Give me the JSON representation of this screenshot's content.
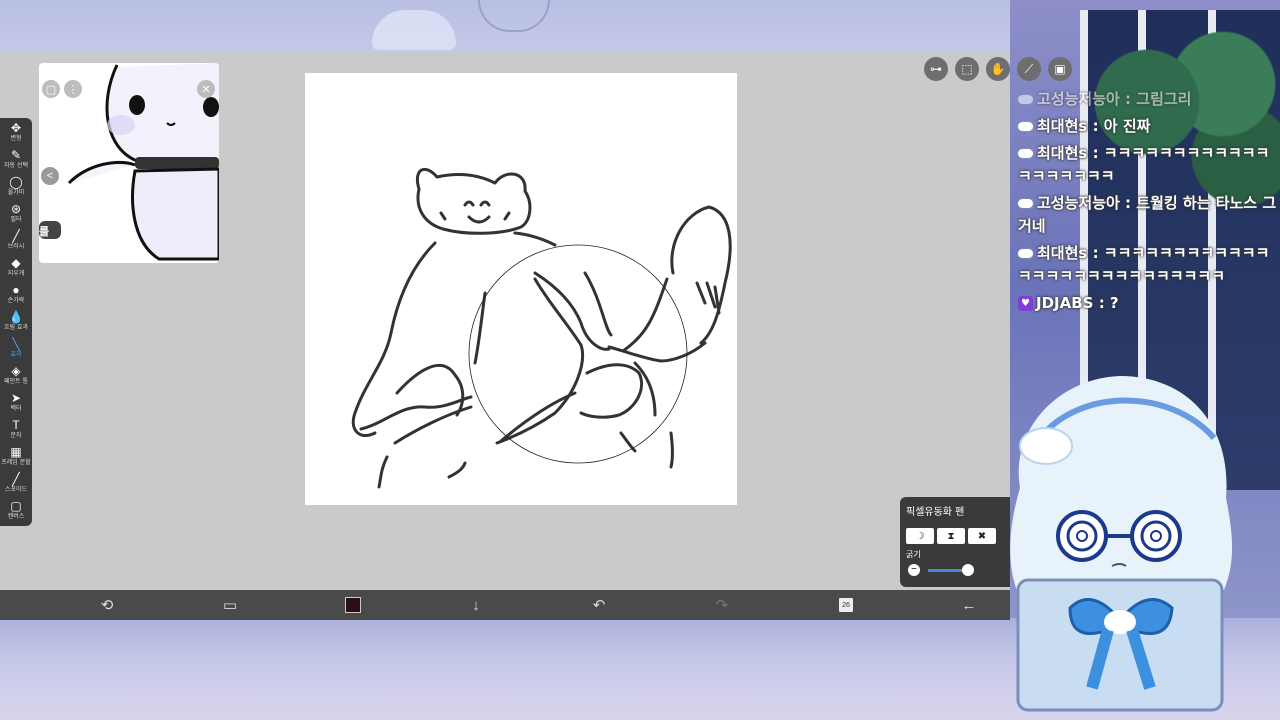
{
  "toolbar": {
    "tools": [
      {
        "id": "transform",
        "label": "변형",
        "icon": "move-icon",
        "glyph": "✥"
      },
      {
        "id": "magic-wand",
        "label": "자동 선택",
        "icon": "magic-wand-icon",
        "glyph": "✎"
      },
      {
        "id": "lasso",
        "label": "올가미",
        "icon": "lasso-icon",
        "glyph": "◯"
      },
      {
        "id": "filter",
        "label": "필터",
        "icon": "fx-icon",
        "glyph": "⊛"
      },
      {
        "id": "brush",
        "label": "브러시",
        "icon": "brush-icon",
        "glyph": "╱"
      },
      {
        "id": "eraser",
        "label": "지우개",
        "icon": "eraser-icon",
        "glyph": "◆"
      },
      {
        "id": "finger",
        "label": "손가락",
        "icon": "finger-icon",
        "glyph": "●"
      },
      {
        "id": "blur",
        "label": "흐림 효과",
        "icon": "drop-icon",
        "glyph": "💧"
      },
      {
        "id": "effect",
        "label": "효과",
        "icon": "sparkle-pen-icon",
        "glyph": "╲"
      },
      {
        "id": "fill",
        "label": "페인트 통",
        "icon": "bucket-icon",
        "glyph": "◈"
      },
      {
        "id": "vector",
        "label": "벡터",
        "icon": "cursor-icon",
        "glyph": "➤"
      },
      {
        "id": "text",
        "label": "문자",
        "icon": "text-icon",
        "glyph": "T"
      },
      {
        "id": "frame",
        "label": "프레임 분할",
        "icon": "frame-icon",
        "glyph": "▦"
      },
      {
        "id": "eyedropper",
        "label": "스포이드",
        "icon": "eyedropper-icon",
        "glyph": "╱"
      },
      {
        "id": "canvas",
        "label": "캔버스",
        "icon": "canvas-icon",
        "glyph": "▢"
      }
    ],
    "active": "effect"
  },
  "reference": {
    "back_glyph": "<",
    "side_label": "를"
  },
  "top_icons": [
    "toggle-icon",
    "selection-icon",
    "hand-icon",
    "ruler-icon",
    "reference-image-icon"
  ],
  "brush_panel": {
    "title": "픽셀유동화 펜",
    "modes": [
      "☽",
      "⧗",
      "✖"
    ],
    "size_label": "굵기",
    "size_value": 0.8
  },
  "bottombar": {
    "items": [
      {
        "name": "transform-quick-icon",
        "glyph": "⟲"
      },
      {
        "name": "brush-quick-icon",
        "glyph": "▭"
      },
      {
        "name": "color-swatch",
        "glyph": ""
      },
      {
        "name": "download-icon",
        "glyph": "↓"
      },
      {
        "name": "undo-icon",
        "glyph": "↶"
      },
      {
        "name": "redo-icon",
        "glyph": "↷"
      },
      {
        "name": "layers-icon",
        "glyph": "26"
      },
      {
        "name": "back-icon",
        "glyph": "←"
      }
    ],
    "color": "#2a0f14"
  },
  "chat": [
    {
      "user": "고성능저능아",
      "text": "그림그리",
      "faded": true,
      "badge": "cloud"
    },
    {
      "user": "최대현s",
      "text": "아 진짜",
      "faded": false,
      "badge": "cloud"
    },
    {
      "user": "최대현s",
      "text": "ㅋㅋㅋㅋㅋㅋㅋㅋㅋㅋㅋㅋㅋㅋㅋㅋㅋㅋㅋ",
      "faded": false,
      "badge": "cloud"
    },
    {
      "user": "고성능저능아",
      "text": "트월킹 하는 타노스 그거네",
      "faded": false,
      "badge": "cloud"
    },
    {
      "user": "최대현s",
      "text": "ㅋㅋㅋㅋㅋㅋㅋㅋㅋㅋㅋㅋㅋㅋㅋㅋㅋㅋㅋㅋㅋㅋㅋㅋㅋㅋㅋ",
      "faded": false,
      "badge": "cloud"
    },
    {
      "user": "JDJABS",
      "text": "?",
      "faded": false,
      "badge": "heart"
    }
  ]
}
